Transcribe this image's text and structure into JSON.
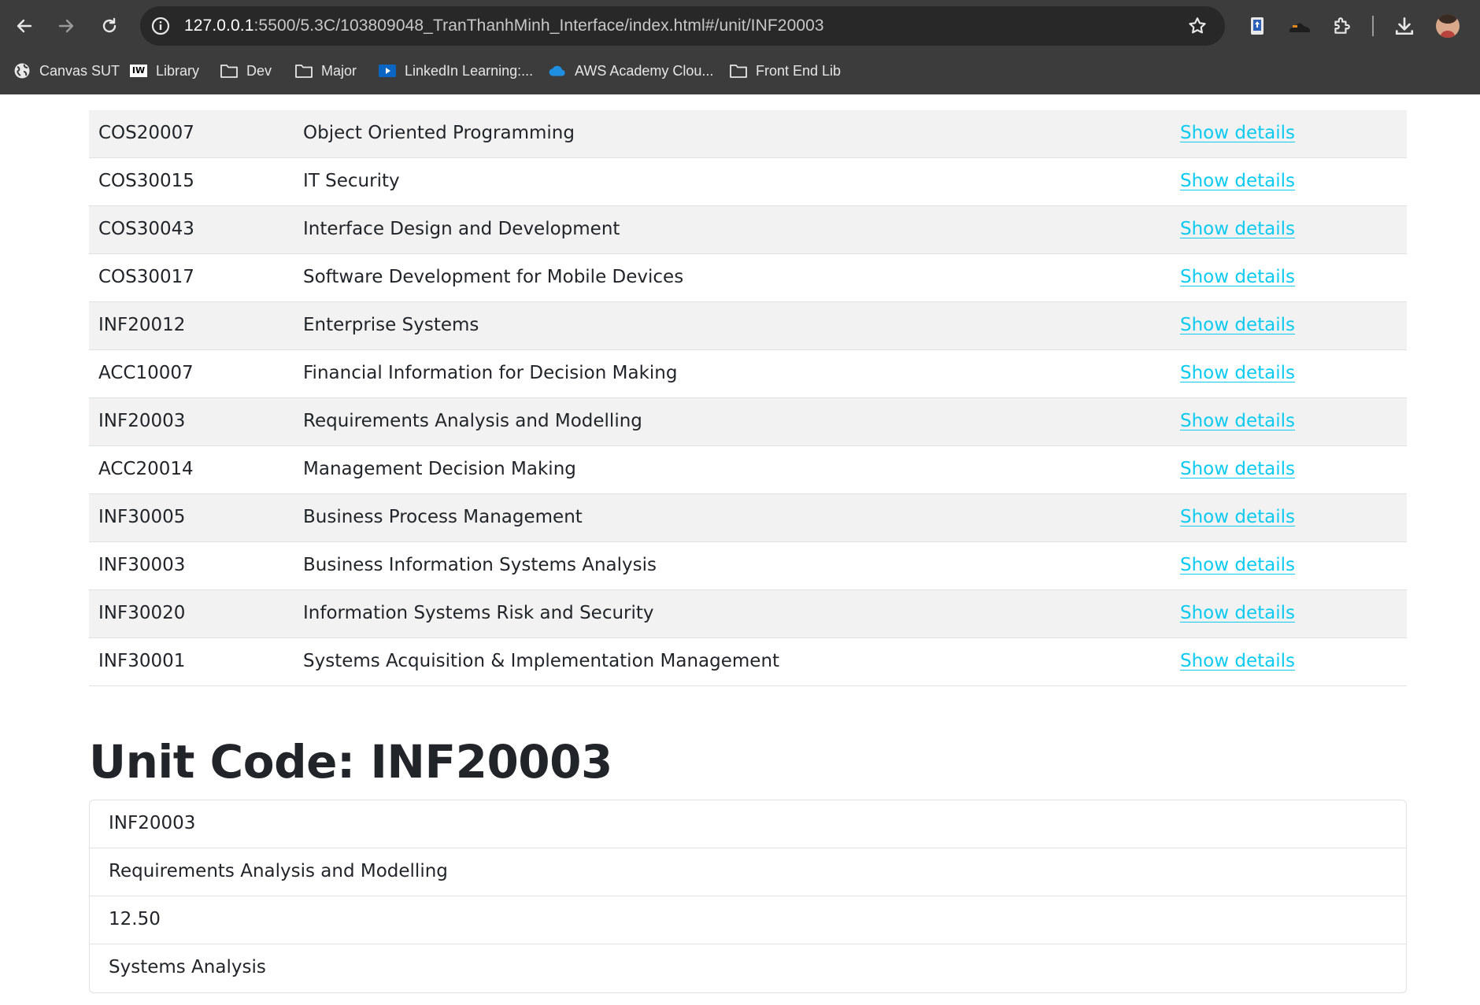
{
  "browser": {
    "url_host": "127.0.0.1",
    "url_rest": ":5500/5.3C/103809048_TranThanhMinh_Interface/index.html#/unit/INF20003",
    "bookmarks": [
      {
        "label": "Canvas SUT",
        "icon": "globe-icon"
      },
      {
        "label": "Library",
        "icon": "iw-icon",
        "badge": "IW"
      },
      {
        "label": "Dev",
        "icon": "folder-icon"
      },
      {
        "label": "Major",
        "icon": "folder-icon"
      },
      {
        "label": "LinkedIn Learning:...",
        "icon": "linkedin-learning-icon"
      },
      {
        "label": "AWS Academy Clou...",
        "icon": "cloud-icon"
      },
      {
        "label": "Front End Lib",
        "icon": "folder-icon"
      }
    ]
  },
  "units_table": {
    "link_label": "Show details",
    "link_color": "#0dcaf0",
    "rows": [
      {
        "code": "COS20007",
        "name": "Object Oriented Programming"
      },
      {
        "code": "COS30015",
        "name": "IT Security"
      },
      {
        "code": "COS30043",
        "name": "Interface Design and Development"
      },
      {
        "code": "COS30017",
        "name": "Software Development for Mobile Devices"
      },
      {
        "code": "INF20012",
        "name": "Enterprise Systems"
      },
      {
        "code": "ACC10007",
        "name": "Financial Information for Decision Making"
      },
      {
        "code": "INF20003",
        "name": "Requirements Analysis and Modelling"
      },
      {
        "code": "ACC20014",
        "name": "Management Decision Making"
      },
      {
        "code": "INF30005",
        "name": "Business Process Management"
      },
      {
        "code": "INF30003",
        "name": "Business Information Systems Analysis"
      },
      {
        "code": "INF30020",
        "name": "Information Systems Risk and Security"
      },
      {
        "code": "INF30001",
        "name": "Systems Acquisition & Implementation Management"
      }
    ]
  },
  "unit_detail": {
    "heading": "Unit Code: INF20003",
    "items": [
      "INF20003",
      "Requirements Analysis and Modelling",
      "12.50",
      "Systems Analysis"
    ]
  }
}
